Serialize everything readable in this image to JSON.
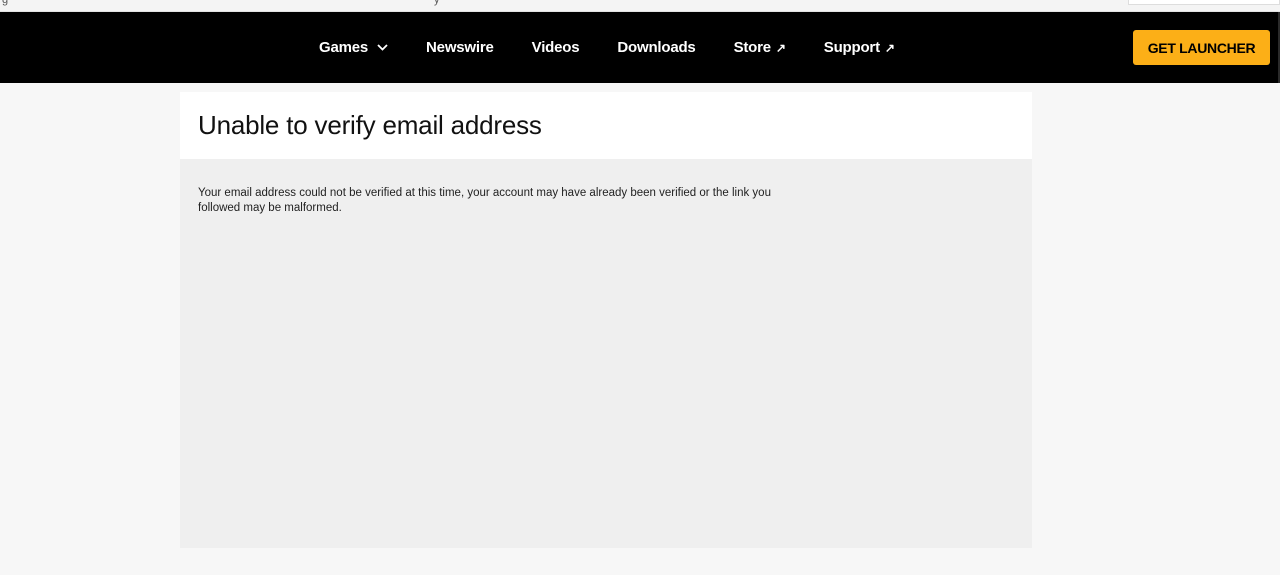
{
  "browser": {
    "tab_fragments": [
      "g",
      "y"
    ]
  },
  "nav": {
    "items": [
      {
        "label": "Games",
        "icon": "chevron-down-icon"
      },
      {
        "label": "Newswire"
      },
      {
        "label": "Videos"
      },
      {
        "label": "Downloads"
      },
      {
        "label": "Store",
        "icon": "external-link-icon"
      },
      {
        "label": "Support",
        "icon": "external-link-icon"
      }
    ],
    "external_glyph": "↗",
    "cta_label": "GET LAUNCHER",
    "cta_color": "#fcaf17"
  },
  "main": {
    "title": "Unable to verify email address",
    "message": "Your email address could not be verified at this time, your account may have already been verified or the link you followed may be malformed."
  }
}
